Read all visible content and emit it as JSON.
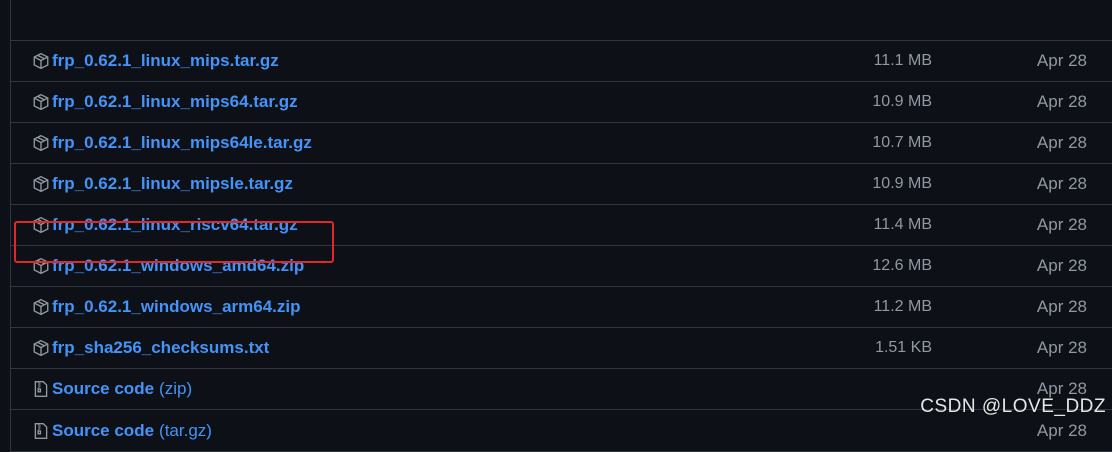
{
  "assets": [
    {
      "name": "frp_0.62.1_linux_mips.tar.gz",
      "size": "11.1 MB",
      "date": "Apr 28",
      "icon": "package-icon"
    },
    {
      "name": "frp_0.62.1_linux_mips64.tar.gz",
      "size": "10.9 MB",
      "date": "Apr 28",
      "icon": "package-icon"
    },
    {
      "name": "frp_0.62.1_linux_mips64le.tar.gz",
      "size": "10.7 MB",
      "date": "Apr 28",
      "icon": "package-icon"
    },
    {
      "name": "frp_0.62.1_linux_mipsle.tar.gz",
      "size": "10.9 MB",
      "date": "Apr 28",
      "icon": "package-icon"
    },
    {
      "name": "frp_0.62.1_linux_riscv64.tar.gz",
      "size": "11.4 MB",
      "date": "Apr 28",
      "icon": "package-icon"
    },
    {
      "name": "frp_0.62.1_windows_amd64.zip",
      "size": "12.6 MB",
      "date": "Apr 28",
      "icon": "package-icon"
    },
    {
      "name": "frp_0.62.1_windows_arm64.zip",
      "size": "11.2 MB",
      "date": "Apr 28",
      "icon": "package-icon"
    },
    {
      "name": "frp_sha256_checksums.txt",
      "size": "1.51 KB",
      "date": "Apr 28",
      "icon": "package-icon"
    }
  ],
  "source_code": [
    {
      "label": "Source code",
      "format": "(zip)",
      "date": "Apr 28",
      "icon": "file-zip-icon"
    },
    {
      "label": "Source code",
      "format": "(tar.gz)",
      "date": "Apr 28",
      "icon": "file-zip-icon"
    }
  ],
  "watermark": "CSDN @LOVE_DDZ",
  "colors": {
    "background": "#0d1117",
    "link": "#4493f8",
    "muted": "#9198a1",
    "border": "#30363d",
    "highlight": "#e0282a"
  }
}
